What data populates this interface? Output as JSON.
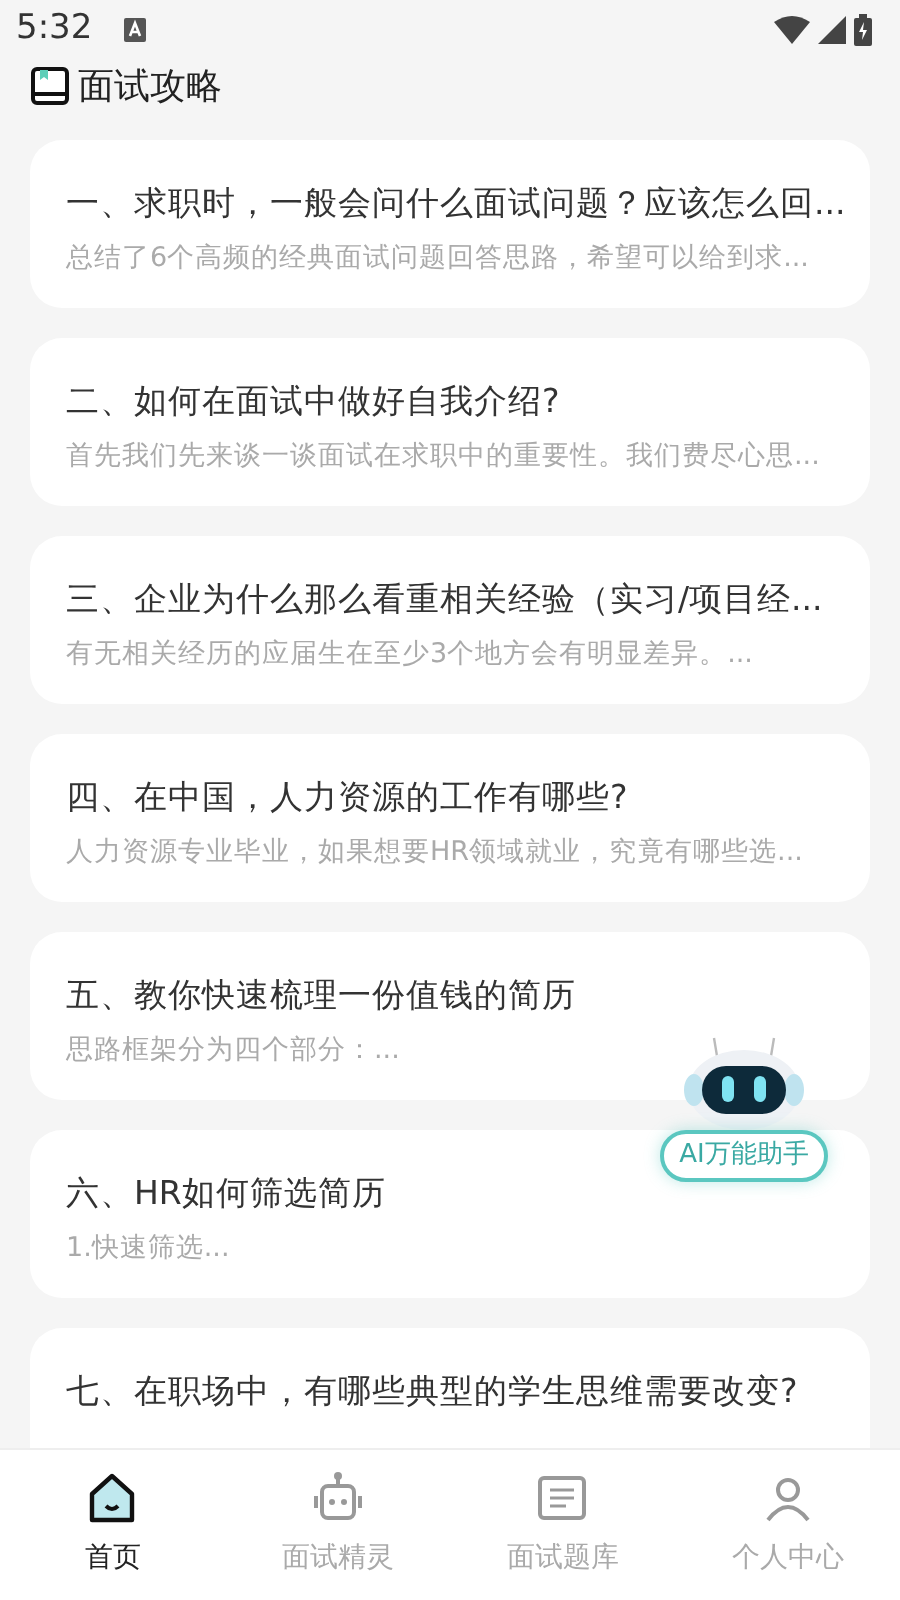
{
  "status_bar": {
    "time": "5:32"
  },
  "header": {
    "title": "面试攻略"
  },
  "articles": [
    {
      "title": "一、求职时，一般会问什么面试问题？应该怎么回...",
      "summary": "总结了6个高频的经典面试问题回答思路，希望可以给到求..."
    },
    {
      "title": "二、如何在面试中做好自我介绍?",
      "summary": "首先我们先来谈一谈面试在求职中的重要性。我们费尽心思..."
    },
    {
      "title": "三、企业为什么那么看重相关经验（实习/项目经...",
      "summary": "有无相关经历的应届生在至少3个地方会有明显差异。..."
    },
    {
      "title": "四、在中国，人力资源的工作有哪些?",
      "summary": "人力资源专业毕业，如果想要HR领域就业，究竟有哪些选..."
    },
    {
      "title": "五、教你快速梳理一份值钱的简历",
      "summary": "思路框架分为四个部分：..."
    },
    {
      "title": "六、HR如何筛选简历",
      "summary": "1.快速筛选..."
    },
    {
      "title": "七、在职场中，有哪些典型的学生思维需要改变?"
    }
  ],
  "assistant": {
    "label": "AI万能助手"
  },
  "tabs": [
    {
      "label": "首页",
      "selected": true
    },
    {
      "label": "面试精灵",
      "selected": false
    },
    {
      "label": "面试题库",
      "selected": false
    },
    {
      "label": "个人中心",
      "selected": false
    }
  ]
}
